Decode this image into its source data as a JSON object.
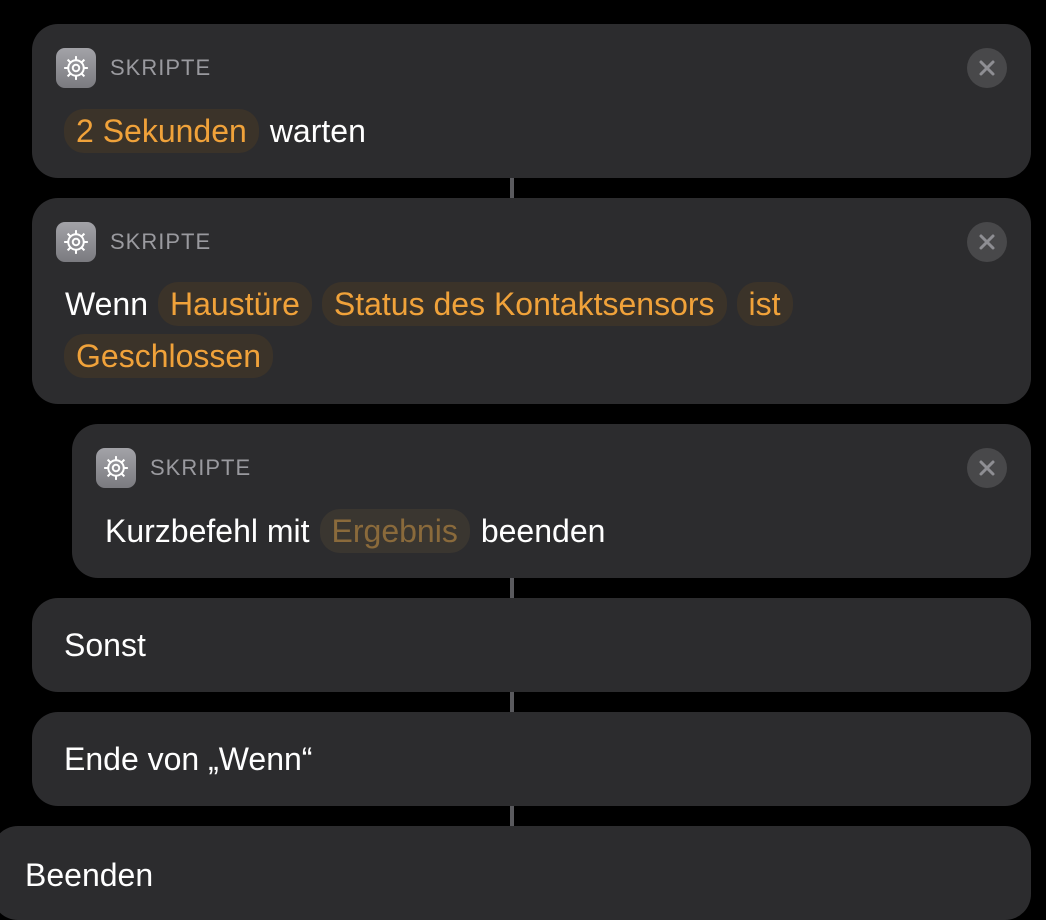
{
  "colors": {
    "background": "#000000",
    "card": "#2c2c2e",
    "token_bg": "#3b3329",
    "token_text": "#f0a23a",
    "token_placeholder_text": "#8a6a3b",
    "category_text": "#9a9a9f",
    "close_bg": "#48484a",
    "connector": "#5a5a5e"
  },
  "actions": [
    {
      "category": "SKRIPTE",
      "icon": "gear-icon",
      "close_icon": "close-icon",
      "duration_token": "2 Sekunden",
      "text_after": "warten"
    },
    {
      "category": "SKRIPTE",
      "icon": "gear-icon",
      "close_icon": "close-icon",
      "text_before": "Wenn",
      "tokens": [
        "Haustüre",
        "Status des Kontaktsensors",
        "ist",
        "Geschlossen"
      ]
    },
    {
      "category": "SKRIPTE",
      "icon": "gear-icon",
      "close_icon": "close-icon",
      "text_before": "Kurzbefehl mit",
      "placeholder_token": "Ergebnis",
      "text_after": "beenden"
    }
  ],
  "otherwise_label": "Sonst",
  "end_if_label": "Ende von „Wenn“",
  "end_label": "Beenden"
}
